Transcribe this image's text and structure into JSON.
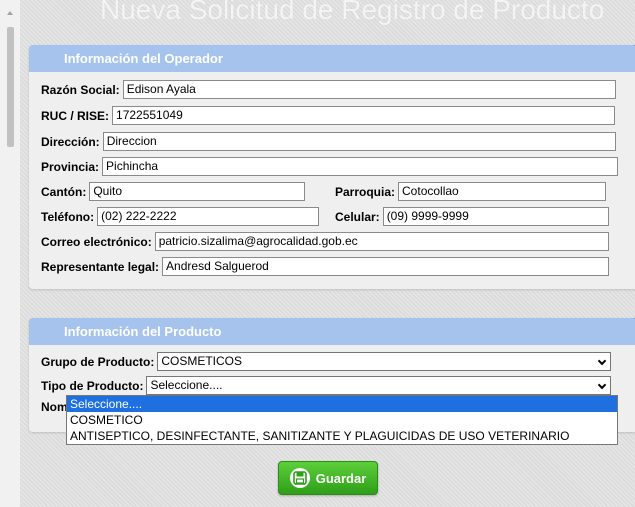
{
  "page": {
    "title": "Nueva Solicitud de Registro de Producto"
  },
  "operator": {
    "header": "Información del Operador",
    "razon_social_label": "Razón Social:",
    "razon_social": "Edison Ayala",
    "ruc_label": "RUC / RISE:",
    "ruc": "1722551049",
    "direccion_label": "Dirección:",
    "direccion": "Direccion",
    "provincia_label": "Provincia:",
    "provincia": "Pichincha",
    "canton_label": "Cantón:",
    "canton": "Quito",
    "parroquia_label": "Parroquia:",
    "parroquia": "Cotocollao",
    "telefono_label": "Teléfono:",
    "telefono": "(02) 222-2222",
    "celular_label": "Celular:",
    "celular": "(09) 9999-9999",
    "correo_label": "Correo electrónico:",
    "correo": "patricio.sizalima@agrocalidad.gob.ec",
    "representante_label": "Representante legal:",
    "representante": "Andresd Salguerod"
  },
  "product": {
    "header": "Información del Producto",
    "grupo_label": "Grupo de Producto:",
    "grupo_value": "COSMETICOS",
    "tipo_label": "Tipo de Producto:",
    "tipo_value": "Seleccione....",
    "nombre_label_partial": "Nom",
    "tipo_options": [
      "Seleccione....",
      "COSMETICO",
      "ANTISEPTICO, DESINFECTANTE, SANITIZANTE Y PLAGUICIDAS DE USO VETERINARIO"
    ]
  },
  "actions": {
    "save_label": "Guardar"
  },
  "colors": {
    "section_header": "#a5c3ec",
    "save_button": "#3cb527",
    "dropdown_highlight": "#1e6fe0"
  },
  "icons": {
    "save": "floppy-disk-icon"
  }
}
